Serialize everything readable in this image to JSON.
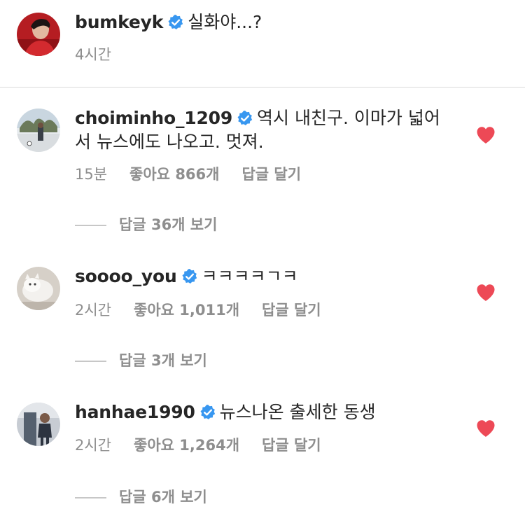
{
  "post": {
    "username": "bumkeyk",
    "caption": "실화야...?",
    "time": "4시간"
  },
  "comments": [
    {
      "username": "choiminho_1209",
      "text_line1": "역시 내친구. 이마가 넓어",
      "text_line2": "서 뉴스에도 나오고. 멋져.",
      "time": "15분",
      "likes": "좋아요 866개",
      "reply": "답글 달기",
      "view_replies": "답글 36개 보기"
    },
    {
      "username": "soooo_you",
      "text_line1": "ㅋㅋㅋㅋㄱㅋ",
      "time": "2시간",
      "likes": "좋아요 1,011개",
      "reply": "답글 달기",
      "view_replies": "답글 3개 보기"
    },
    {
      "username": "hanhae1990",
      "text_line1": "뉴스나온 출세한 동생",
      "time": "2시간",
      "likes": "좋아요 1,264개",
      "reply": "답글 달기",
      "view_replies": "답글 6개 보기"
    }
  ],
  "colors": {
    "verified": "#3897f0",
    "heart": "#ed4956",
    "meta_text": "#8e8e8e",
    "primary_text": "#262626"
  },
  "icons": {
    "verified": "verified-badge-icon",
    "like": "heart-filled-icon"
  }
}
